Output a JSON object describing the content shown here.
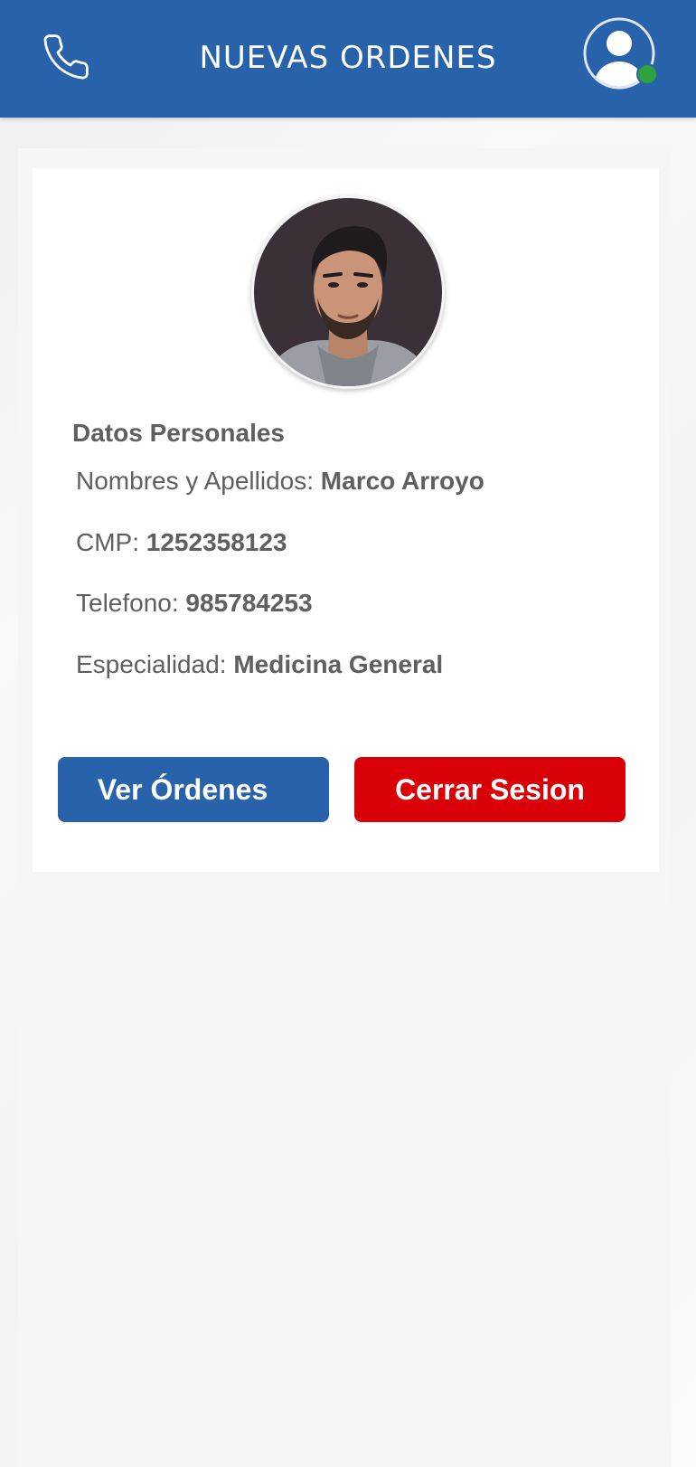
{
  "header": {
    "title": "NUEVAS ORDENES",
    "phone_icon": "phone-icon",
    "avatar_icon": "user-avatar-icon",
    "status": "online"
  },
  "profile": {
    "photo": "profile-photo",
    "section_title": "Datos Personales",
    "fields": [
      {
        "label": "Nombres y Apellidos:",
        "value": "Marco Arroyo"
      },
      {
        "label": "CMP:",
        "value": "1252358123"
      },
      {
        "label": "Telefono:",
        "value": "985784253"
      },
      {
        "label": "Especialidad:",
        "value": "Medicina General"
      }
    ]
  },
  "actions": {
    "orders_label": "Ver Órdenes",
    "logout_label": "Cerrar Sesion"
  },
  "colors": {
    "primary": "#2762ab",
    "danger": "#d90008",
    "online": "#2ea23f",
    "text": "#5f5f5f"
  }
}
